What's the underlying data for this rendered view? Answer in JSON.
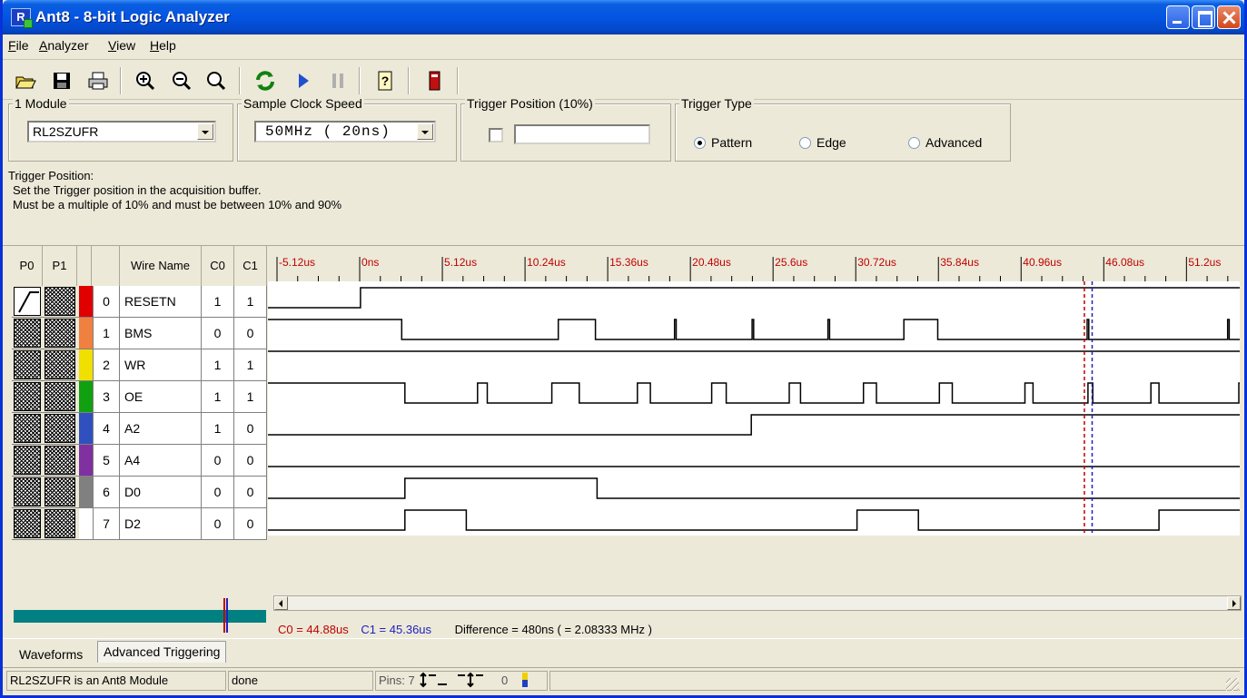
{
  "window": {
    "title": "Ant8 - 8-bit Logic Analyzer",
    "app_icon_letter": "R"
  },
  "menu": {
    "items": [
      "File",
      "Analyzer",
      "View",
      "Help"
    ]
  },
  "toolbar": {
    "buttons": [
      "open-icon",
      "save-icon",
      "print-icon",
      "zoom-in-icon",
      "zoom-out-icon",
      "zoom-fit-icon",
      "refresh-icon",
      "run-icon",
      "pause-icon",
      "help-icon",
      "exit-icon"
    ]
  },
  "settings": {
    "module": {
      "label": "1 Module",
      "value": "RL2SZUFR"
    },
    "clock": {
      "label": "Sample Clock Speed",
      "value": "50MHz ( 20ns)"
    },
    "trigger_position": {
      "label": "Trigger Position (10%)",
      "checked": false,
      "value": ""
    },
    "trigger_type": {
      "label": "Trigger Type",
      "options": [
        "Pattern",
        "Edge",
        "Advanced"
      ],
      "selected": "Pattern"
    }
  },
  "description": {
    "title": "Trigger Position:",
    "lines": [
      "Set the Trigger position in the acquisition buffer.",
      "Must be a multiple of 10% and must be between 10% and 90%"
    ]
  },
  "columns": {
    "p0": "P0",
    "p1": "P1",
    "wire_name": "Wire Name",
    "c0": "C0",
    "c1": "C1"
  },
  "time_axis": {
    "labels": [
      "-5.12us",
      "0ns",
      "5.12us",
      "10.24us",
      "15.36us",
      "20.48us",
      "25.6us",
      "30.72us",
      "35.84us",
      "40.96us",
      "46.08us",
      "51.2us"
    ],
    "start_us": -5.12,
    "end_us": 54.5,
    "major_step_us": 5.12
  },
  "signals": [
    {
      "index": "0",
      "name": "RESETN",
      "c0": "1",
      "c1": "1",
      "color": "#e00000",
      "p0": "rising",
      "p1": "dontcare",
      "init": 0,
      "transitions": [
        0.05
      ]
    },
    {
      "index": "1",
      "name": "BMS",
      "c0": "0",
      "c1": "0",
      "color": "#f08040",
      "p0": "dontcare",
      "p1": "dontcare",
      "init": 1,
      "transitions": [
        2.6,
        12.3,
        14.6,
        19.5,
        19.6,
        24.3,
        24.4,
        29.0,
        29.1,
        33.7,
        35.8,
        45.05,
        45.15,
        53.75,
        53.85
      ]
    },
    {
      "index": "2",
      "name": "WR",
      "c0": "1",
      "c1": "1",
      "color": "#f0e000",
      "p0": "dontcare",
      "p1": "dontcare",
      "init": 1,
      "transitions": []
    },
    {
      "index": "3",
      "name": "OE",
      "c0": "1",
      "c1": "1",
      "color": "#10a010",
      "p0": "dontcare",
      "p1": "dontcare",
      "init": 1,
      "transitions": [
        2.8,
        7.3,
        7.9,
        11.9,
        13.6,
        17.2,
        18.0,
        21.8,
        22.7,
        26.6,
        27.3,
        31.2,
        32.0,
        35.9,
        36.7,
        41.2,
        41.7,
        45.1,
        45.4,
        49.0,
        49.5,
        54.5
      ]
    },
    {
      "index": "4",
      "name": "A2",
      "c0": "1",
      "c1": "0",
      "color": "#3050c0",
      "p0": "dontcare",
      "p1": "dontcare",
      "init": 0,
      "transitions": [
        24.25
      ]
    },
    {
      "index": "5",
      "name": "A4",
      "c0": "0",
      "c1": "0",
      "color": "#8030a0",
      "p0": "dontcare",
      "p1": "dontcare",
      "init": 0,
      "transitions": []
    },
    {
      "index": "6",
      "name": "D0",
      "c0": "0",
      "c1": "0",
      "color": "#808080",
      "p0": "dontcare",
      "p1": "dontcare",
      "init": 0,
      "transitions": [
        2.8,
        14.7
      ]
    },
    {
      "index": "7",
      "name": "D2",
      "c0": "0",
      "c1": "0",
      "color": "#ffffff",
      "p0": "dontcare",
      "p1": "dontcare",
      "init": 0,
      "transitions": [
        2.8,
        6.6,
        30.8,
        34.6,
        49.5
      ]
    }
  ],
  "cursors": {
    "c0_us": 44.88,
    "c1_us": 45.36,
    "c0_color": "#c00000",
    "c1_color": "#2020c0"
  },
  "cursor_info": {
    "c0": "C0 = 44.88us",
    "c1": "C1 = 45.36us",
    "difference": "Difference = 480ns ( = 2.08333 MHz )"
  },
  "tabs": {
    "active": "Waveforms",
    "inactive": "Advanced Triggering"
  },
  "status": {
    "module_info": "RL2SZUFR is an Ant8 Module",
    "state": "done",
    "pins_label": "Pins: 7",
    "pins_end": "0"
  }
}
